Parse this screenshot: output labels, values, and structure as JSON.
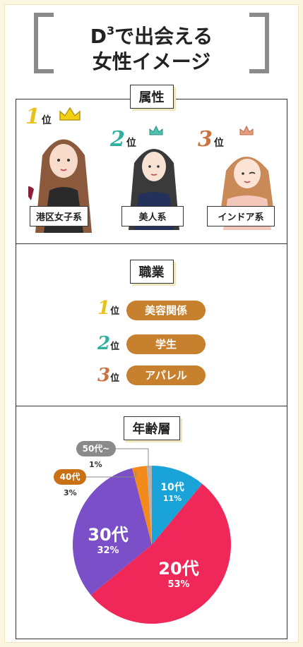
{
  "header": {
    "title_line1_prefix": "D",
    "title_sup": "3",
    "title_line1_suffix": "で出会える",
    "title_line2": "女性イメージ"
  },
  "attribute_section": {
    "title": "属性",
    "ranks": [
      {
        "num": "1",
        "suffix": "位",
        "label": "港区女子系"
      },
      {
        "num": "2",
        "suffix": "位",
        "label": "美人系"
      },
      {
        "num": "3",
        "suffix": "位",
        "label": "インドア系"
      }
    ]
  },
  "occupation_section": {
    "title": "職業",
    "ranks": [
      {
        "num": "1",
        "suffix": "位",
        "label": "美容関係"
      },
      {
        "num": "2",
        "suffix": "位",
        "label": "学生"
      },
      {
        "num": "3",
        "suffix": "位",
        "label": "アパレル"
      }
    ]
  },
  "age_section": {
    "title": "年齢層"
  },
  "chart_data": {
    "type": "pie",
    "categories": [
      "10代",
      "20代",
      "30代",
      "40代",
      "50代~"
    ],
    "values": [
      11,
      53,
      32,
      3,
      1
    ],
    "labels_pct": [
      "11%",
      "53%",
      "32%",
      "3%",
      "1%"
    ],
    "colors": [
      "#1aa3d9",
      "#f0285a",
      "#7a4fc8",
      "#f28a1e",
      "#b3b3b3"
    ]
  }
}
